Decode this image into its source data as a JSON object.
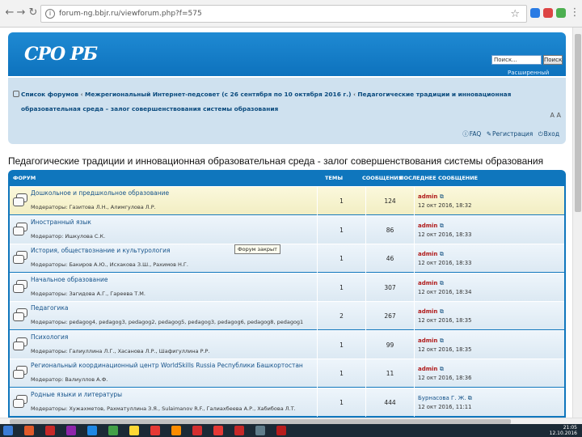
{
  "browser": {
    "url": "forum-ng.bbjr.ru/viewforum.php?f=575"
  },
  "header": {
    "logo_text": "СРО РБ",
    "search_placeholder": "Поиск...",
    "search_button": "Поиск",
    "advanced_search": "Расширенный поиск"
  },
  "navbar": {
    "crumbs": [
      "Список форумов",
      "Межрегиональный Интернет-педсовет (с 26 сентября по 10 октября 2016 г.)",
      "Педагогические традиции и инновационная образовательная среда – залог совершенствования системы образования"
    ],
    "faq": "FAQ",
    "register": "Регистрация",
    "login": "Вход"
  },
  "page_title": "Педагогические традиции и инновационная образовательная среда - залог совершенствования системы образования",
  "table": {
    "headers": {
      "forum": "ФОРУМ",
      "topics": "ТЕМЫ",
      "posts": "СООБЩЕНИЯ",
      "last_post": "ПОСЛЕДНЕЕ СООБЩЕНИЕ"
    },
    "rows": [
      {
        "title": "Дошкольное и предшкольное образование",
        "moderators": "Модераторы: Газитова Л.Н., Алимгулова Л.Р.",
        "topics": "1",
        "posts": "124",
        "author": "admin",
        "date": "12 окт 2016, 18:32"
      },
      {
        "title": "Иностранный язык",
        "moderators": "Модератор: Ишкулова С.К.",
        "topics": "1",
        "posts": "86",
        "author": "admin",
        "date": "12 окт 2016, 18:33"
      },
      {
        "title": "История, обществознание и культурология",
        "moderators": "Модераторы: Бакиров А.Ю., Исхакова З.Ш., Рахимов Н.Г.",
        "topics": "1",
        "posts": "46",
        "author": "admin",
        "date": "12 окт 2016, 18:33"
      },
      {
        "title": "Начальное образование",
        "moderators": "Модераторы: Загидова А.Г., Гареева Т.М.",
        "topics": "1",
        "posts": "307",
        "author": "admin",
        "date": "12 окт 2016, 18:34"
      },
      {
        "title": "Педагогика",
        "moderators": "Модераторы: pedagog4, pedagog3, pedagog2, pedagog5, pedagog3, pedagog6, pedagog8, pedagog1",
        "topics": "2",
        "posts": "267",
        "author": "admin",
        "date": "12 окт 2016, 18:35"
      },
      {
        "title": "Психология",
        "moderators": "Модераторы: Галиуллина Л.Г., Хасанова Л.Р., Шафигуллина Р.Р.",
        "topics": "1",
        "posts": "99",
        "author": "admin",
        "date": "12 окт 2016, 18:35"
      },
      {
        "title": "Региональный координационный центр WorldSkills Russia Республики Башкортостан",
        "moderators": "Модератор: Валиуллов А.Ф.",
        "topics": "1",
        "posts": "11",
        "author": "admin",
        "date": "12 окт 2016, 18:36"
      },
      {
        "title": "Родные языки и литературы",
        "moderators": "Модераторы: Хужахметов, Рахматуллина З.Я., Sulaimanov R.F., Галиахбеева А.Р., Хабибова Л.Т.",
        "topics": "1",
        "posts": "444",
        "author": "Бурнасова Г. Ж.",
        "date": "12 окт 2016, 11:11",
        "plain_author": true
      }
    ]
  },
  "tooltip": "Форум закрыт",
  "clock": {
    "time": "21:05",
    "date": "12.10.2016"
  }
}
